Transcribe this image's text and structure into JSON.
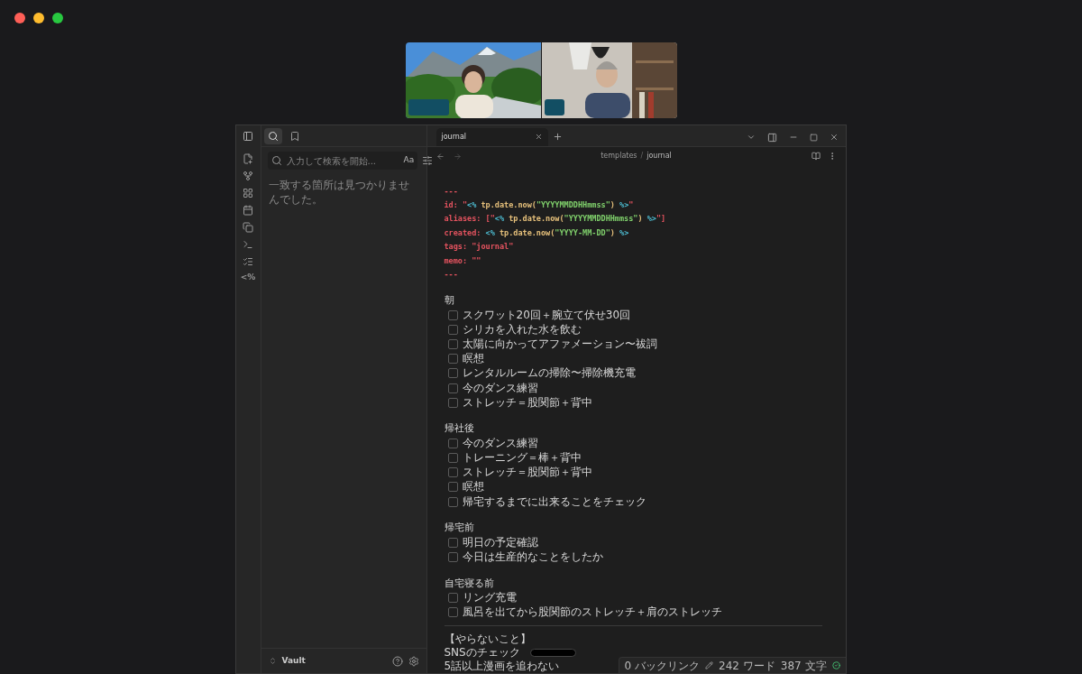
{
  "sidebar": {
    "tabs": [
      {
        "selected": true
      },
      {
        "selected": false
      }
    ],
    "ribbon_glyph": "<%",
    "search": {
      "placeholder": "入力して検索を開始...",
      "case_toggle": "Aa",
      "empty_message": "一致する箇所は見つかりませんでした。"
    },
    "vault": "Vault"
  },
  "tabs": [
    {
      "title": "journal",
      "selected": true
    }
  ],
  "breadcrumb": {
    "folder": "templates",
    "separator": "/",
    "file": "journal"
  },
  "frontmatter": [
    {
      "segments": [
        {
          "kind": "key",
          "text": "---"
        }
      ]
    },
    {
      "segments": [
        {
          "kind": "key",
          "text": "id: \""
        },
        {
          "kind": "tag",
          "text": "<% "
        },
        {
          "kind": "fn",
          "text": "tp.date.now("
        },
        {
          "kind": "lit",
          "text": "\"YYYYMMDDHHmmss\""
        },
        {
          "kind": "fn",
          "text": ")"
        },
        {
          "kind": "tag",
          "text": " %>"
        },
        {
          "kind": "key",
          "text": "\""
        }
      ]
    },
    {
      "segments": [
        {
          "kind": "key",
          "text": "aliases: [\""
        },
        {
          "kind": "tag",
          "text": "<% "
        },
        {
          "kind": "fn",
          "text": "tp.date.now("
        },
        {
          "kind": "lit",
          "text": "\"YYYYMMDDHHmmss\""
        },
        {
          "kind": "fn",
          "text": ")"
        },
        {
          "kind": "tag",
          "text": " %>"
        },
        {
          "kind": "key",
          "text": "\"]"
        }
      ]
    },
    {
      "segments": [
        {
          "kind": "key",
          "text": "created: "
        },
        {
          "kind": "tag",
          "text": "<% "
        },
        {
          "kind": "fn",
          "text": "tp.date.now("
        },
        {
          "kind": "lit",
          "text": "\"YYYY-MM-DD\""
        },
        {
          "kind": "fn",
          "text": ")"
        },
        {
          "kind": "tag",
          "text": " %>"
        }
      ]
    },
    {
      "segments": [
        {
          "kind": "key",
          "text": "tags: \"journal\""
        }
      ]
    },
    {
      "segments": [
        {
          "kind": "key",
          "text": "memo: \"\""
        }
      ]
    },
    {
      "segments": [
        {
          "kind": "key",
          "text": "---"
        }
      ]
    }
  ],
  "sections": [
    {
      "heading": "朝",
      "tasks": [
        {
          "text": "スクワット20回＋腕立て伏せ30回",
          "checked": false
        },
        {
          "text": "シリカを入れた水を飲む",
          "checked": false
        },
        {
          "text": "太陽に向かってアファメーション〜祓詞",
          "checked": false
        },
        {
          "text": "瞑想",
          "checked": false
        },
        {
          "text": "レンタルルームの掃除〜掃除機充電",
          "checked": false
        },
        {
          "text": "今のダンス練習",
          "checked": false
        },
        {
          "text": "ストレッチ＝股関節＋背中",
          "checked": false
        }
      ]
    },
    {
      "heading": "帰社後",
      "tasks": [
        {
          "text": "今のダンス練習",
          "checked": false
        },
        {
          "text": "トレーニング＝棒＋背中",
          "checked": false
        },
        {
          "text": "ストレッチ＝股関節＋背中",
          "checked": false
        },
        {
          "text": "瞑想",
          "checked": false
        },
        {
          "text": "帰宅するまでに出来ることをチェック",
          "checked": false
        }
      ]
    },
    {
      "heading": "帰宅前",
      "tasks": [
        {
          "text": "明日の予定確認",
          "checked": false
        },
        {
          "text": "今日は生産的なことをしたか",
          "checked": false
        }
      ]
    },
    {
      "heading": "自宅寝る前",
      "tasks": [
        {
          "text": "リング充電",
          "checked": false
        },
        {
          "text": "風呂を出てから股関節のストレッチ＋肩のストレッチ",
          "checked": false
        }
      ]
    }
  ],
  "dont_list": {
    "heading": "【やらないこと】",
    "items": [
      {
        "text": "SNSのチェック",
        "redacted": true
      },
      {
        "text": "5話以上漫画を追わない",
        "redacted": false
      }
    ]
  },
  "status_bar": {
    "backlinks": "0 バックリンク",
    "words": "242 ワード",
    "chars": "387 文字"
  }
}
